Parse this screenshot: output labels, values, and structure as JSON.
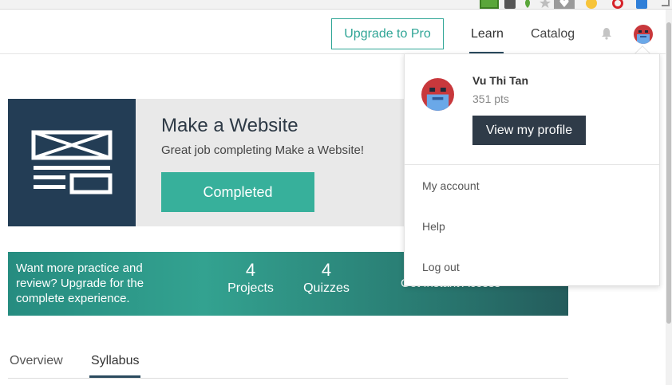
{
  "extensions": [
    "cart-icon",
    "screen-icon",
    "leaf-icon",
    "star-icon",
    "heart-icon",
    "smiley-icon",
    "opera-icon",
    "puzzle-icon",
    "more-icon"
  ],
  "header": {
    "upgrade_label": "Upgrade to Pro",
    "nav": {
      "learn": "Learn",
      "catalog": "Catalog"
    }
  },
  "course": {
    "title": "Make a Website",
    "subtitle": "Great job completing Make a Website!",
    "status_label": "Completed"
  },
  "promo": {
    "text": "Want more practice and review? Upgrade for the complete experience.",
    "projects": {
      "count": "4",
      "label": "Projects"
    },
    "quizzes": {
      "count": "4",
      "label": "Quizzes"
    },
    "cta": "Get Instant Access »"
  },
  "tabs": {
    "overview": "Overview",
    "syllabus": "Syllabus"
  },
  "dropdown": {
    "user_name": "Vu Thi Tan",
    "points": "351 pts",
    "profile_button": "View my profile",
    "items": [
      "My account",
      "Help",
      "Log out"
    ]
  },
  "colors": {
    "accent": "#37b09b",
    "dark_navy": "#233d55",
    "profile_button": "#2f3b48"
  }
}
